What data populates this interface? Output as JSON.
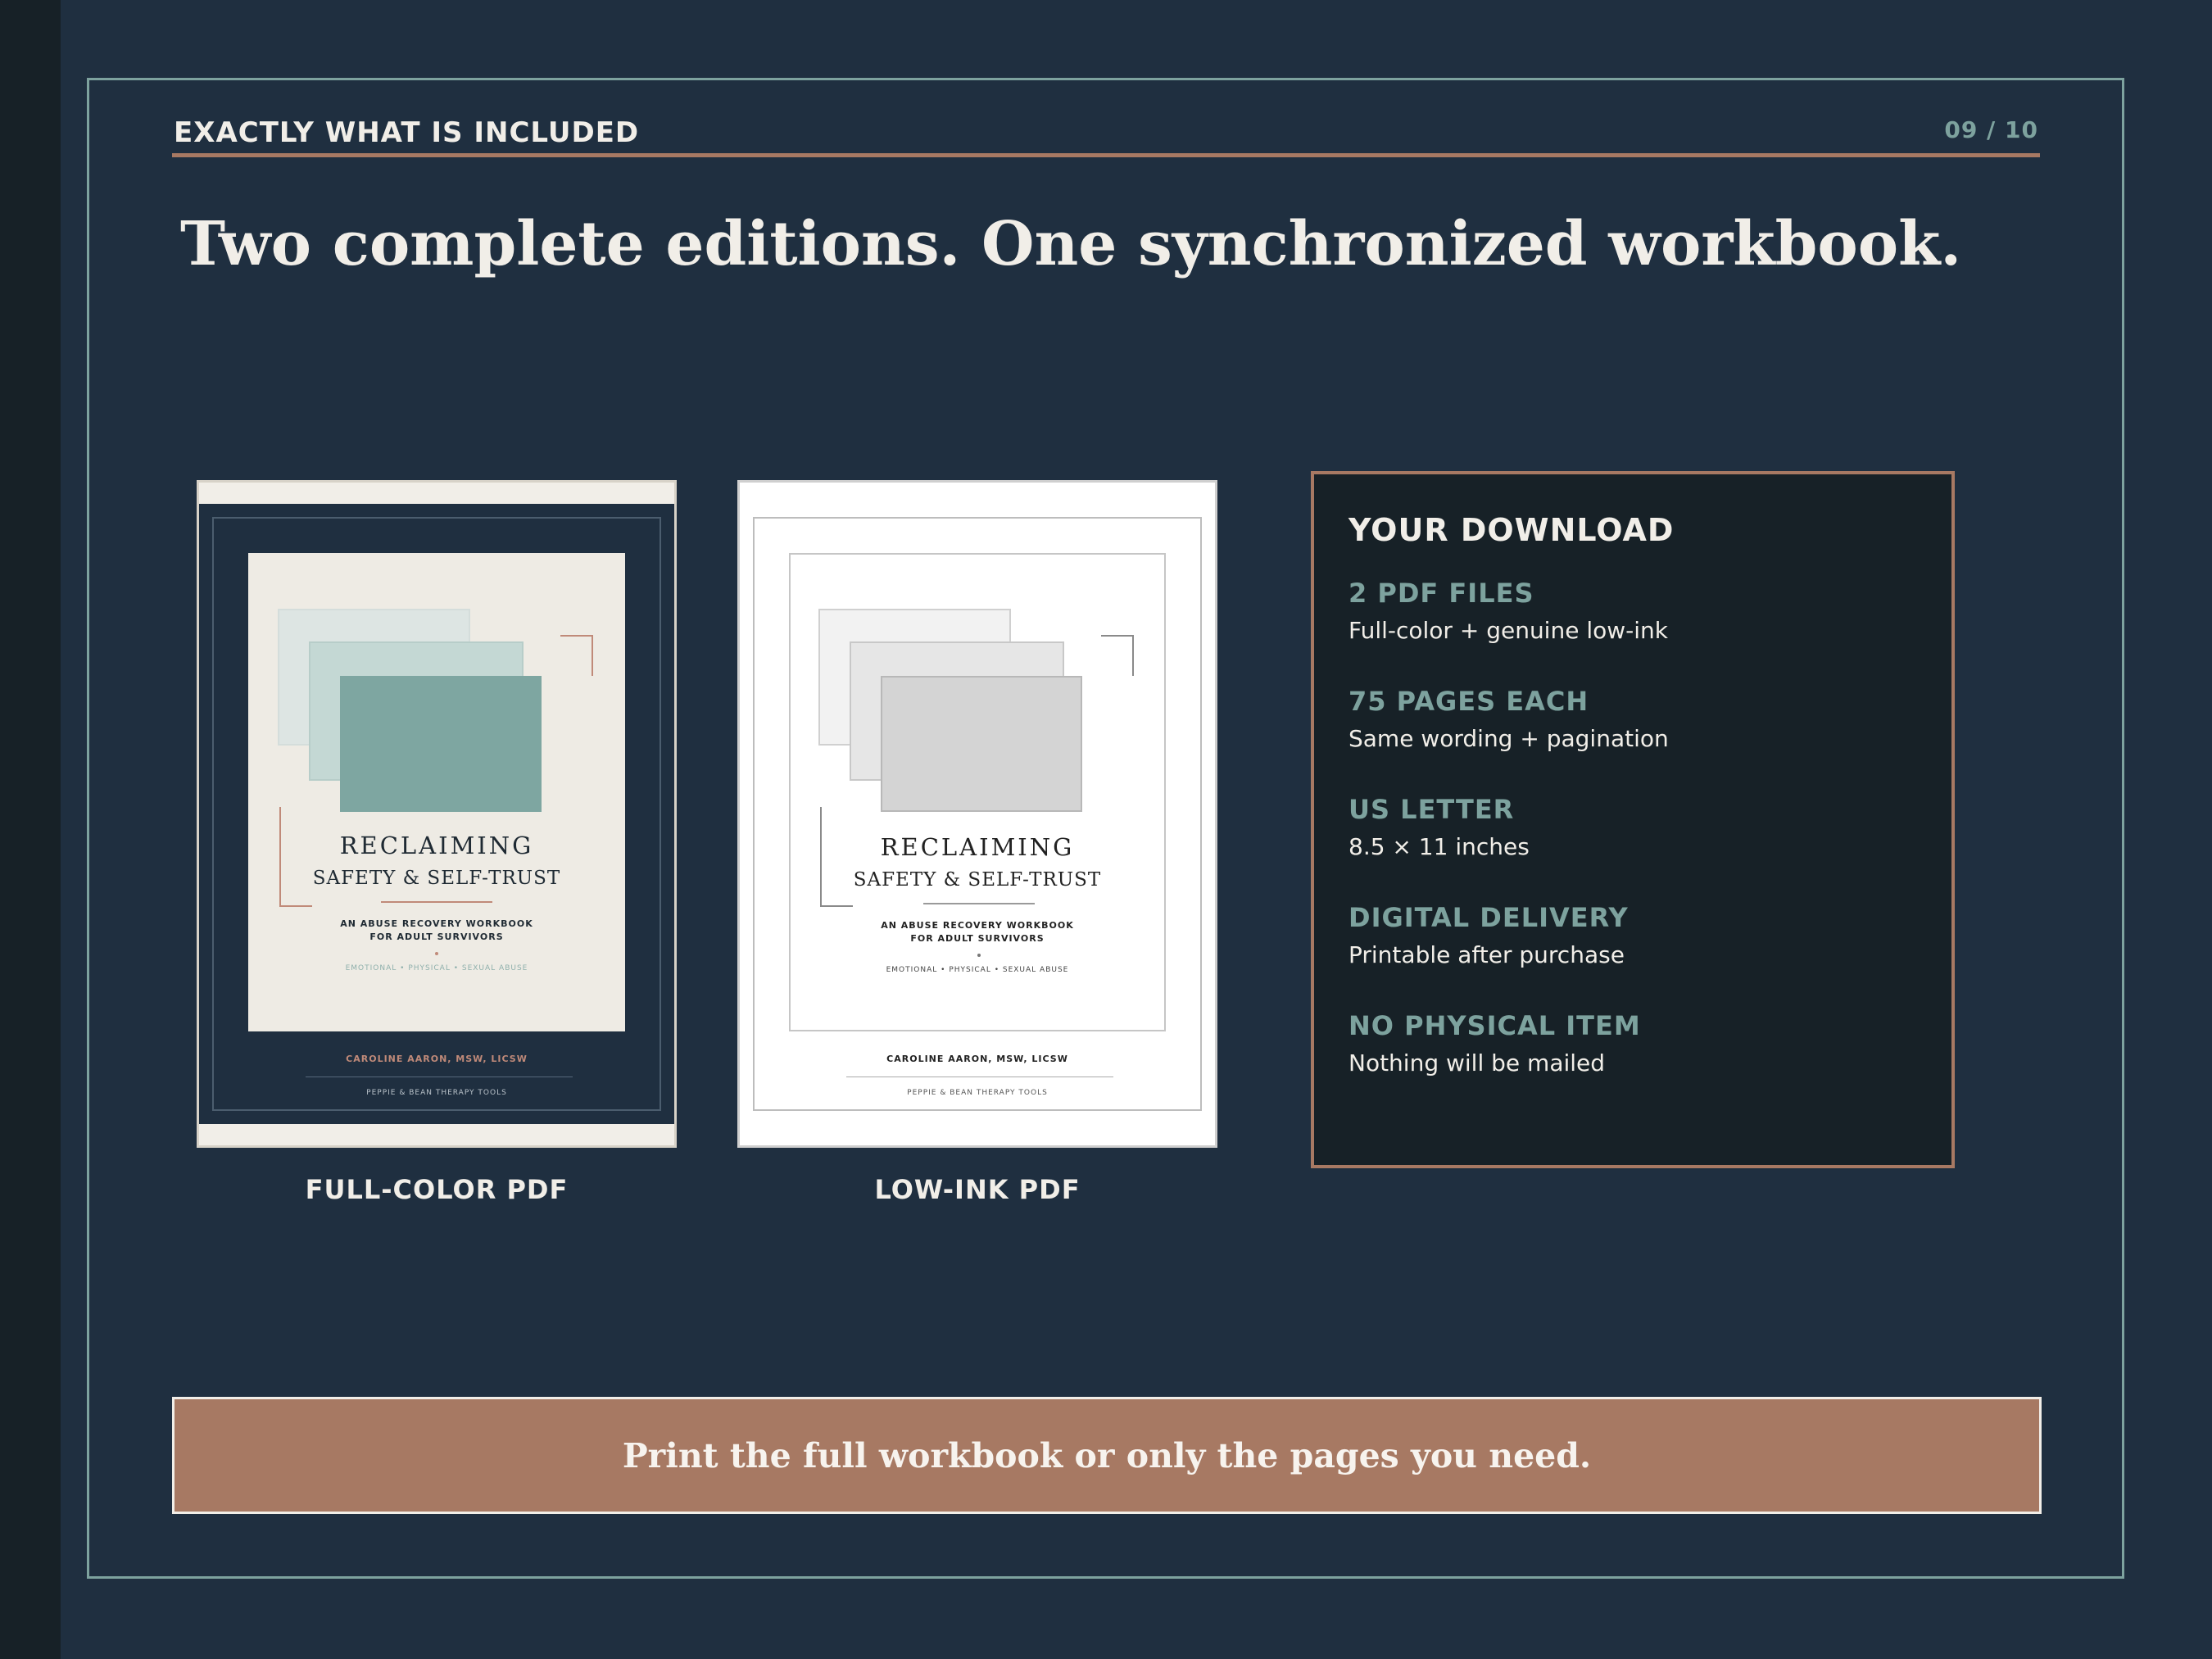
{
  "header": {
    "eyebrow": "EXACTLY WHAT IS INCLUDED",
    "page_number": "09 / 10",
    "headline": "Two complete editions. One synchronized workbook."
  },
  "covers": [
    {
      "edition": "full-color",
      "label": "FULL-COLOR PDF",
      "title_line1": "RECLAIMING",
      "title_line2": "SAFETY & SELF-TRUST",
      "subtitle_line1": "AN ABUSE RECOVERY WORKBOOK",
      "subtitle_line2": "FOR ADULT SURVIVORS",
      "tags": "EMOTIONAL  •  PHYSICAL  •  SEXUAL ABUSE",
      "author": "CAROLINE AARON, MSW, LICSW",
      "publisher": "PEPPIE & BEAN THERAPY TOOLS"
    },
    {
      "edition": "low-ink",
      "label": "LOW-INK PDF",
      "title_line1": "RECLAIMING",
      "title_line2": "SAFETY & SELF-TRUST",
      "subtitle_line1": "AN ABUSE RECOVERY WORKBOOK",
      "subtitle_line2": "FOR ADULT SURVIVORS",
      "tags": "EMOTIONAL  •  PHYSICAL  •  SEXUAL ABUSE",
      "author": "CAROLINE AARON, MSW, LICSW",
      "publisher": "PEPPIE & BEAN THERAPY TOOLS"
    }
  ],
  "download": {
    "title": "YOUR DOWNLOAD",
    "items": [
      {
        "key": "2 PDF FILES",
        "value": "Full-color + genuine low-ink"
      },
      {
        "key": "75 PAGES EACH",
        "value": "Same wording + pagination"
      },
      {
        "key": "US LETTER",
        "value": "8.5 × 11 inches"
      },
      {
        "key": "DIGITAL DELIVERY",
        "value": "Printable after purchase"
      },
      {
        "key": "NO PHYSICAL ITEM",
        "value": "Nothing will be mailed"
      }
    ]
  },
  "cta": {
    "text": "Print the full workbook or only the pages you need."
  },
  "colors": {
    "background": "#1f2f40",
    "accent_teal": "#7da29e",
    "accent_copper": "#a77963",
    "panel_dark": "#172127",
    "text_light": "#f1eee8"
  }
}
